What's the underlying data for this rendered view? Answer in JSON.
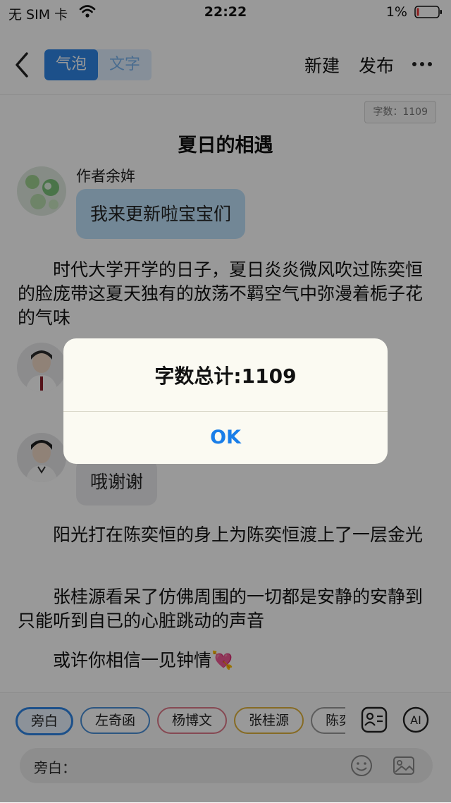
{
  "status_bar": {
    "carrier": "无 SIM 卡",
    "time": "22:22",
    "battery": "1%"
  },
  "nav": {
    "back_icon": "chevron-left-icon",
    "segments": [
      "气泡",
      "文字"
    ],
    "active_segment": "气泡",
    "new_label": "新建",
    "publish_label": "发布",
    "more_icon": "more-icon"
  },
  "word_count_badge": "字数：1109",
  "story_title": "夏日的相遇",
  "messages": [
    {
      "speaker": "作者余姩",
      "text": "我来更新啦宝宝们",
      "bubble_color": "#bfe2fb"
    },
    {
      "speaker": "",
      "text": "哦谢谢",
      "bubble_color": "#ececee"
    }
  ],
  "paragraphs": [
    "时代大学开学的日子，夏日炎炎微风吹过陈奕恒的脸庞带这夏天独有的放荡不羁空气中弥漫着栀子花的气味",
    "阳光打在陈奕恒的身上为陈奕恒渡上了一层金光",
    "张桂源看呆了仿佛周围的一切都是安静的安静到只能听到自已的心脏跳动的声音",
    "或许你相信一见钟情💘"
  ],
  "roles": [
    "旁白",
    "左奇函",
    "杨博文",
    "张桂源",
    "陈奕"
  ],
  "tool_icons": [
    "contact-card-icon",
    "ai-icon"
  ],
  "input": {
    "prefix": "旁白：",
    "value": "",
    "icons": [
      "emoji-icon",
      "image-icon"
    ]
  },
  "alert": {
    "message": "字数总计:1109",
    "ok_label": "OK"
  },
  "colors": {
    "accent": "#2f86e6",
    "alert_button": "#1a7ee8"
  }
}
